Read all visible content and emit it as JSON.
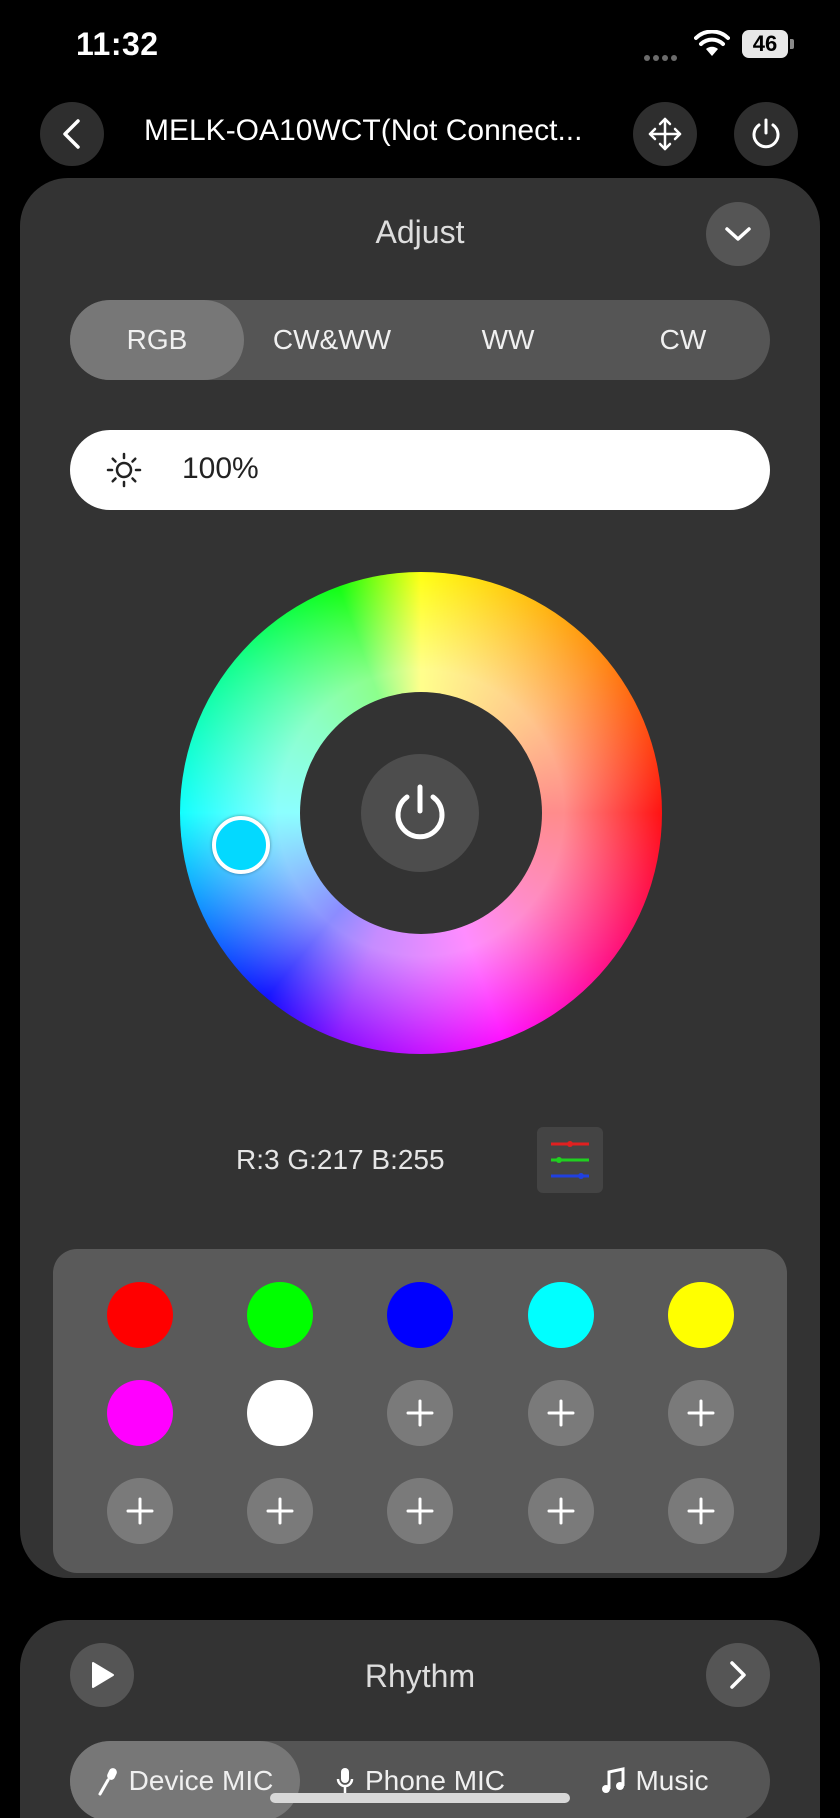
{
  "status_bar": {
    "time": "11:32",
    "battery": "46"
  },
  "header": {
    "title": "MELK-OA10WCT(Not Connect..."
  },
  "adjust": {
    "title": "Adjust",
    "mode_tabs": [
      {
        "label": "RGB",
        "active": true
      },
      {
        "label": "CW&WW",
        "active": false
      },
      {
        "label": "WW",
        "active": false
      },
      {
        "label": "CW",
        "active": false
      }
    ],
    "brightness": "100%",
    "selected_color": "#03d9ff",
    "rgb_readout": "R:3 G:217 B:255",
    "swatches": [
      {
        "color": "#ff0000"
      },
      {
        "color": "#00ff00"
      },
      {
        "color": "#0000ff"
      },
      {
        "color": "#00ffff"
      },
      {
        "color": "#ffff00"
      },
      {
        "color": "#ff00ff"
      },
      {
        "color": "#ffffff"
      },
      {
        "color": "add"
      },
      {
        "color": "add"
      },
      {
        "color": "add"
      },
      {
        "color": "add"
      },
      {
        "color": "add"
      },
      {
        "color": "add"
      },
      {
        "color": "add"
      },
      {
        "color": "add"
      }
    ]
  },
  "rhythm": {
    "title": "Rhythm",
    "tabs": [
      {
        "label": "Device MIC",
        "icon": "microphone-icon",
        "active": true
      },
      {
        "label": "Phone MIC",
        "icon": "mic-icon",
        "active": false
      },
      {
        "label": "Music",
        "icon": "music-note-icon",
        "active": false
      }
    ]
  }
}
